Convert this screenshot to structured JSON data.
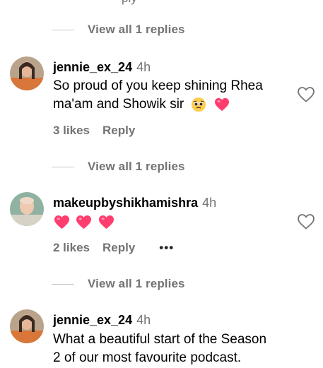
{
  "top_cut": "ply",
  "threads": [
    {
      "view_replies": "View all 1 replies"
    },
    {
      "view_replies": "View all 1 replies"
    },
    {
      "view_replies": "View all 1 replies"
    }
  ],
  "comments": [
    {
      "username": "jennie_ex_24",
      "time": "4h",
      "line1": "So proud of you keep shining Rhea",
      "line2": "ma'am and Showik sir",
      "emojis": [
        "pleading-face-icon",
        "heart-icon"
      ],
      "likes": "3 likes",
      "reply": "Reply"
    },
    {
      "username": "makeupbyshikhamishra",
      "time": "4h",
      "emojis": [
        "heart-icon",
        "heart-icon",
        "heart-icon"
      ],
      "likes": "2 likes",
      "reply": "Reply",
      "more": "•••"
    },
    {
      "username": "jennie_ex_24",
      "time": "4h",
      "line1": "What a beautiful start of the Season",
      "line2": "2 of our most favourite podcast."
    }
  ],
  "colors": {
    "muted": "#737373",
    "heart": "#ff3d6e",
    "divider": "#c7c7c7"
  }
}
